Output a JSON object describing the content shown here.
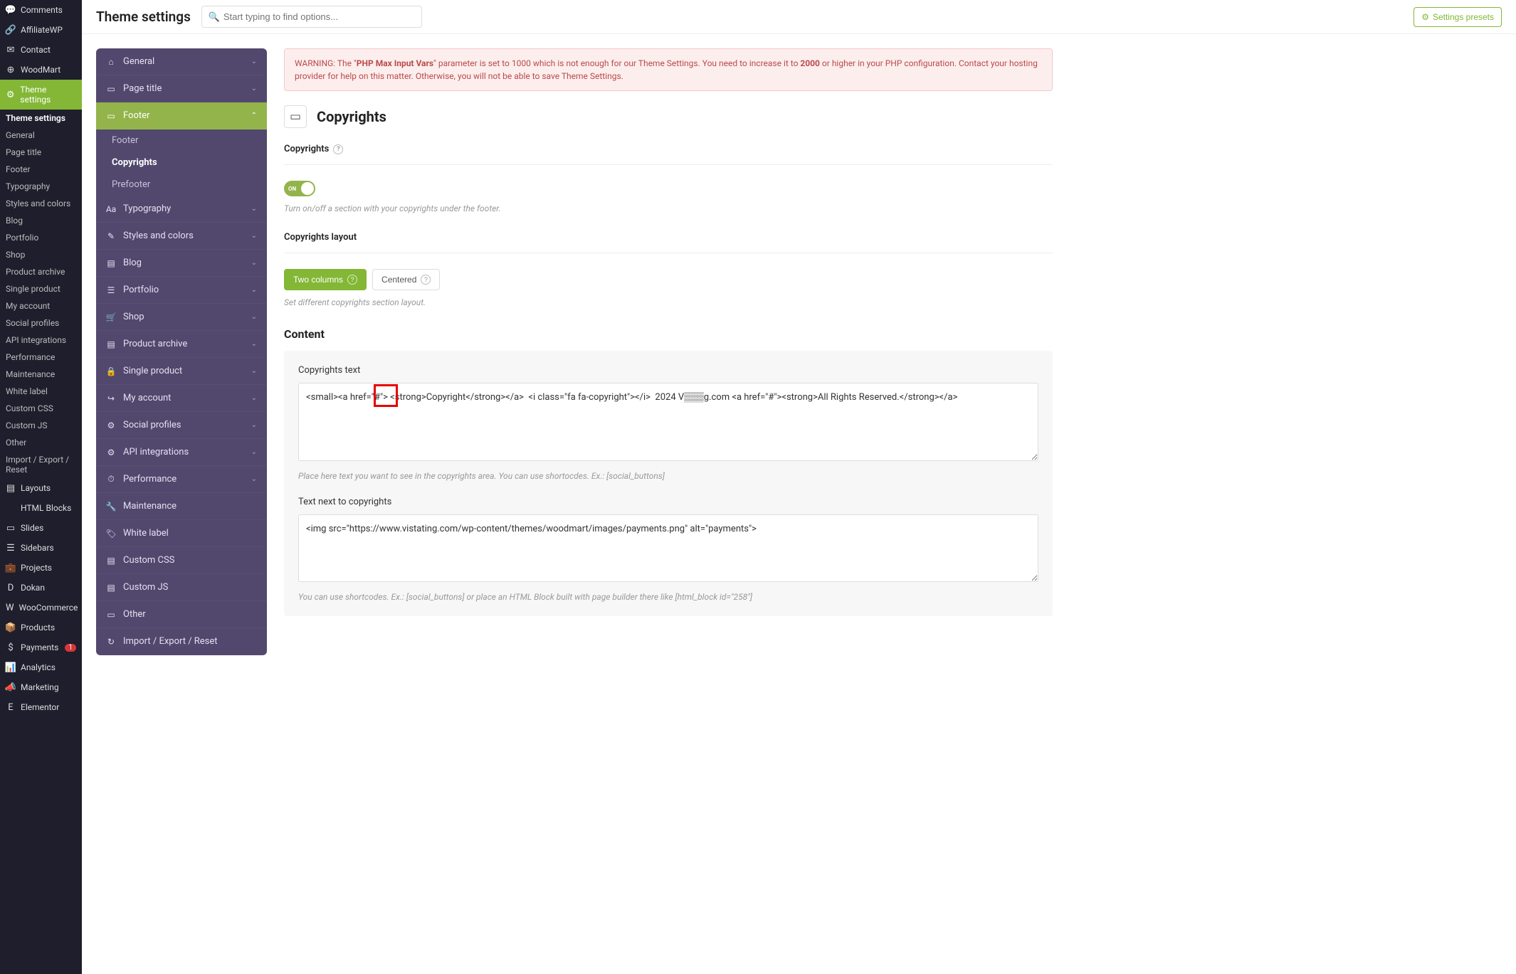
{
  "header": {
    "title": "Theme settings",
    "search_placeholder": "Start typing to find options...",
    "presets_btn": "Settings presets"
  },
  "wp_sidebar": {
    "items": [
      {
        "label": "Comments",
        "icon": "💬"
      },
      {
        "label": "AffiliateWP",
        "icon": "🔗"
      },
      {
        "label": "Contact",
        "icon": "✉"
      },
      {
        "label": "WoodMart",
        "icon": "⊕",
        "hasSub": true
      },
      {
        "label": "Theme settings",
        "icon": "⚙",
        "active": true
      }
    ],
    "theme_sub": [
      {
        "label": "Theme settings",
        "bold": true
      },
      {
        "label": "General"
      },
      {
        "label": "Page title"
      },
      {
        "label": "Footer"
      },
      {
        "label": "Typography"
      },
      {
        "label": "Styles and colors"
      },
      {
        "label": "Blog"
      },
      {
        "label": "Portfolio"
      },
      {
        "label": "Shop"
      },
      {
        "label": "Product archive"
      },
      {
        "label": "Single product"
      },
      {
        "label": "My account"
      },
      {
        "label": "Social profiles"
      },
      {
        "label": "API integrations"
      },
      {
        "label": "Performance"
      },
      {
        "label": "Maintenance"
      },
      {
        "label": "White label"
      },
      {
        "label": "Custom CSS"
      },
      {
        "label": "Custom JS"
      },
      {
        "label": "Other"
      },
      {
        "label": "Import / Export / Reset"
      }
    ],
    "tail": [
      {
        "label": "Layouts",
        "icon": "▤"
      },
      {
        "label": "HTML Blocks",
        "icon": "</>"
      },
      {
        "label": "Slides",
        "icon": "▭"
      },
      {
        "label": "Sidebars",
        "icon": "☰"
      },
      {
        "label": "Projects",
        "icon": "💼"
      },
      {
        "label": "Dokan",
        "icon": "D"
      },
      {
        "label": "WooCommerce",
        "icon": "W"
      },
      {
        "label": "Products",
        "icon": "📦"
      },
      {
        "label": "Payments",
        "icon": "$",
        "badge": "1"
      },
      {
        "label": "Analytics",
        "icon": "📊"
      },
      {
        "label": "Marketing",
        "icon": "📣"
      },
      {
        "label": "Elementor",
        "icon": "E"
      }
    ]
  },
  "sections": [
    {
      "label": "General",
      "icon": "⌂"
    },
    {
      "label": "Page title",
      "icon": "▭"
    },
    {
      "label": "Footer",
      "icon": "▭",
      "open": true,
      "subs": [
        {
          "label": "Footer"
        },
        {
          "label": "Copyrights",
          "active": true
        },
        {
          "label": "Prefooter"
        }
      ]
    },
    {
      "label": "Typography",
      "icon": "Aa"
    },
    {
      "label": "Styles and colors",
      "icon": "✎"
    },
    {
      "label": "Blog",
      "icon": "▤"
    },
    {
      "label": "Portfolio",
      "icon": "☰"
    },
    {
      "label": "Shop",
      "icon": "🛒"
    },
    {
      "label": "Product archive",
      "icon": "▤"
    },
    {
      "label": "Single product",
      "icon": "🔒"
    },
    {
      "label": "My account",
      "icon": "↪"
    },
    {
      "label": "Social profiles",
      "icon": "⚙"
    },
    {
      "label": "API integrations",
      "icon": "⚙"
    },
    {
      "label": "Performance",
      "icon": "⏱"
    },
    {
      "label": "Maintenance",
      "icon": "🔧"
    },
    {
      "label": "White label",
      "icon": "🏷"
    },
    {
      "label": "Custom CSS",
      "icon": "▤"
    },
    {
      "label": "Custom JS",
      "icon": "▤"
    },
    {
      "label": "Other",
      "icon": "▭"
    },
    {
      "label": "Import / Export / Reset",
      "icon": "↻"
    }
  ],
  "warning": {
    "pre": "WARNING: The \"",
    "b1": "PHP Max Input Vars",
    "mid": "\" parameter is set to 1000 which is not enough for our Theme Settings. You need to increase it to ",
    "b2": "2000",
    "post": " or higher in your PHP configuration. Contact your hosting provider for help on this matter. Otherwise, you will not be able to save Theme Settings."
  },
  "panel": {
    "heading": "Copyrights",
    "f1_label": "Copyrights",
    "toggle_on": "ON",
    "f1_desc": "Turn on/off a section with your copyrights under the footer.",
    "f2_label": "Copyrights layout",
    "seg_two": "Two columns",
    "seg_centered": "Centered",
    "f2_desc": "Set different copyrights section layout.",
    "content_head": "Content",
    "ta1_label": "Copyrights text",
    "ta1_value": "<small><a href=\"#\"> <strong>Copyright</strong></a>  <i class=\"fa fa-copyright\"></i>  2024 V▒▒▒g.com <a href=\"#\"><strong>All Rights Reserved.</strong></a>",
    "ta1_desc": "Place here text you want to see in the copyrights area. You can use shortocdes. Ex.: [social_buttons]",
    "ta2_label": "Text next to copyrights",
    "ta2_value": "<img src=\"https://www.vistating.com/wp-content/themes/woodmart/images/payments.png\" alt=\"payments\">",
    "ta2_desc": "You can use shortcodes. Ex.: [social_buttons] or place an HTML Block built with page builder there like [html_block id=\"258\"]"
  }
}
